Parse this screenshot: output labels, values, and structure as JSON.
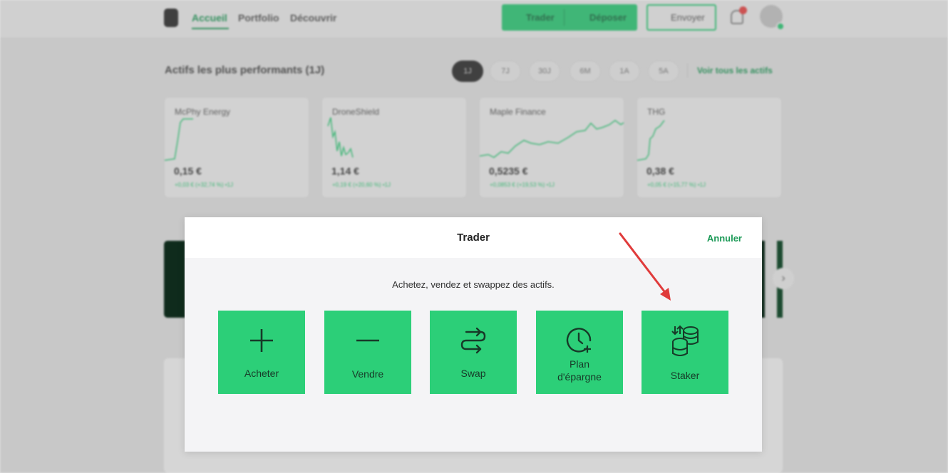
{
  "nav": {
    "items": [
      "Accueil",
      "Portfolio",
      "Découvrir"
    ],
    "trader_label": "Trader",
    "deposer_label": "Déposer",
    "envoyer_label": "Envoyer"
  },
  "top_assets": {
    "title": "Actifs les plus performants (1J)",
    "periods": [
      "1J",
      "7J",
      "30J",
      "6M",
      "1A",
      "5A"
    ],
    "active_period": "1J",
    "see_all": "Voir tous les actifs",
    "assets": [
      {
        "name": "McPhy Energy",
        "price": "0,15 €",
        "change": "+0,03 € (+32,74 %) •1J"
      },
      {
        "name": "DroneShield",
        "price": "1,14 €",
        "change": "+0,19 € (+20,60 %) •1J"
      },
      {
        "name": "Maple Finance",
        "price": "0,5235 €",
        "change": "+0,0853 € (+19,53 %) •1J"
      },
      {
        "name": "THG",
        "price": "0,38 €",
        "change": "+0,05 € (+15,77 %) •1J"
      }
    ]
  },
  "modal": {
    "title": "Trader",
    "cancel": "Annuler",
    "subtitle": "Achetez, vendez et swappez des actifs.",
    "actions": [
      {
        "label": "Acheter",
        "icon": "plus-icon"
      },
      {
        "label": "Vendre",
        "icon": "minus-icon"
      },
      {
        "label": "Swap",
        "icon": "swap-icon"
      },
      {
        "label": "Plan d'épargne",
        "label_line1": "Plan",
        "label_line2": "d'épargne",
        "icon": "clock-plus-icon"
      },
      {
        "label": "Staker",
        "icon": "coins-stack-icon"
      }
    ]
  },
  "colors": {
    "accent_green": "#2ccf78",
    "link_green": "#1c9a57",
    "annotation_red": "#e03b3b"
  }
}
